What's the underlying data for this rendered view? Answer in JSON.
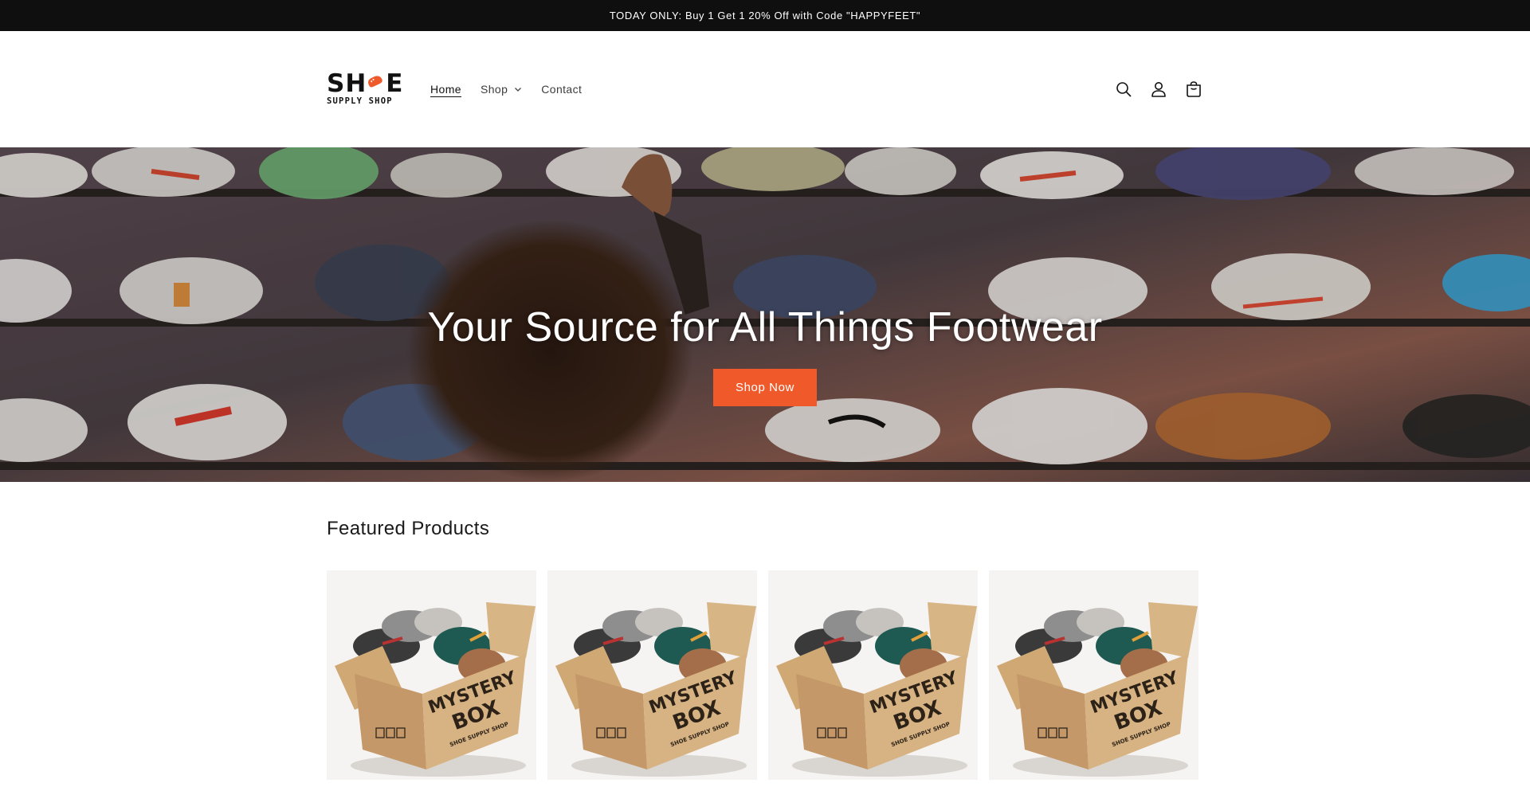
{
  "announcement": {
    "text": "TODAY ONLY: Buy 1 Get 1 20% Off with Code \"HAPPYFEET\""
  },
  "logo": {
    "top_left": "SH",
    "top_right": "E",
    "bottom": "SUPPLY SHOP"
  },
  "nav": {
    "home": "Home",
    "shop": "Shop",
    "contact": "Contact"
  },
  "header_icons": [
    "search-icon",
    "account-icon",
    "cart-icon"
  ],
  "hero": {
    "title": "Your Source for All Things Footwear",
    "button": "Shop Now"
  },
  "featured": {
    "title": "Featured Products",
    "products": [
      {
        "image_text": "MYSTERY BOX",
        "image_subtext": "SHOE SUPPLY SHOP"
      },
      {
        "image_text": "MYSTERY BOX",
        "image_subtext": "SHOE SUPPLY SHOP"
      },
      {
        "image_text": "MYSTERY BOX",
        "image_subtext": "SHOE SUPPLY SHOP"
      },
      {
        "image_text": "MYSTERY BOX",
        "image_subtext": "SHOE SUPPLY SHOP"
      }
    ]
  },
  "colors": {
    "accent": "#f05a2b",
    "announcement_bg": "#0f0f0f",
    "text": "#121212"
  }
}
